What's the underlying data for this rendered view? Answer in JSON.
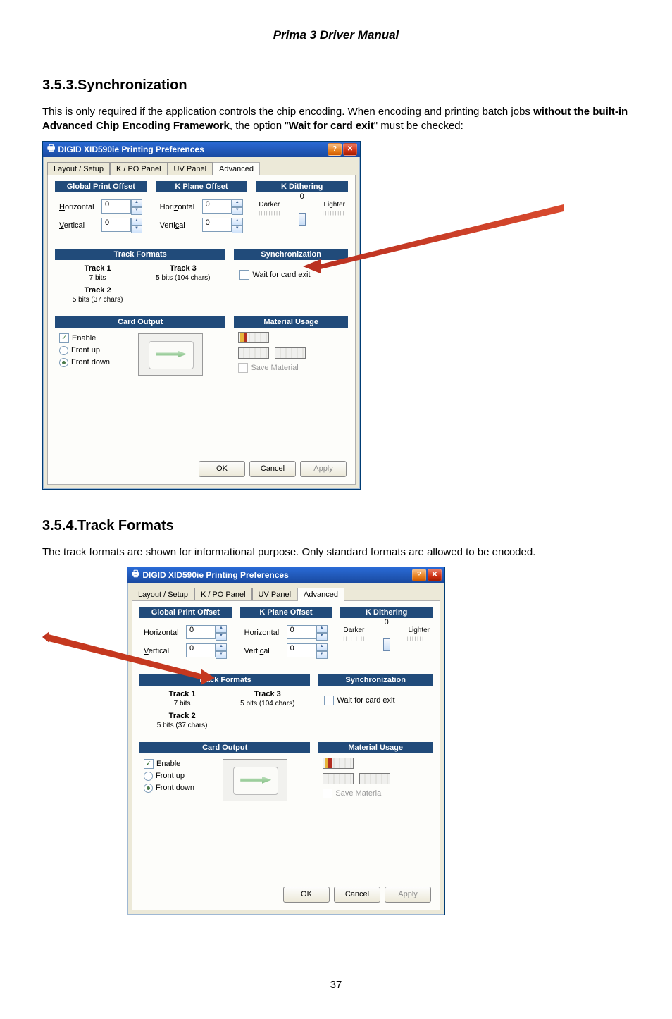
{
  "doc_title": "Prima 3 Driver Manual",
  "sections": {
    "sync": {
      "num": "3.5.3.",
      "heading": "Synchronization",
      "para": "This is only required if the application controls the chip encoding. When encoding and printing batch jobs ",
      "bold1": "without the built-in Advanced Chip Encoding Framework",
      "mid": ", the option \"",
      "bold2": "Wait for card exit",
      "end": "\" must be checked:"
    },
    "track": {
      "num": "3.5.4.",
      "heading": "Track Formats",
      "para": "The track formats are shown for informational purpose. Only standard formats are allowed to be encoded."
    }
  },
  "dialog": {
    "title": "DIGID XID590ie Printing Preferences",
    "tabs": [
      "Layout / Setup",
      "K / PO Panel",
      "UV Panel",
      "Advanced"
    ],
    "global_print_offset": {
      "title": "Global Print Offset",
      "h_label": "Horizontal",
      "v_label": "Vertical",
      "h": "0",
      "v": "0"
    },
    "k_plane_offset": {
      "title": "K Plane Offset",
      "h_label": "Horizontal",
      "v_label": "Vertical",
      "h": "0",
      "v": "0"
    },
    "k_dithering": {
      "title": "K Dithering",
      "center": "0",
      "darker": "Darker",
      "lighter": "Lighter"
    },
    "track_formats": {
      "title": "Track Formats",
      "t1": "Track 1",
      "t1s": "7 bits",
      "t2": "Track 2",
      "t2s": "5 bits  (37 chars)",
      "t3": "Track 3",
      "t3s": "5 bits  (104 chars)"
    },
    "sync": {
      "title": "Synchronization",
      "wait_label": "Wait for card exit"
    },
    "card_output": {
      "title": "Card Output",
      "enable": "Enable",
      "front_up": "Front up",
      "front_down": "Front down"
    },
    "material_usage": {
      "title": "Material Usage",
      "save": "Save Material"
    },
    "buttons": {
      "ok": "OK",
      "cancel": "Cancel",
      "apply": "Apply"
    }
  },
  "page_num": "37"
}
